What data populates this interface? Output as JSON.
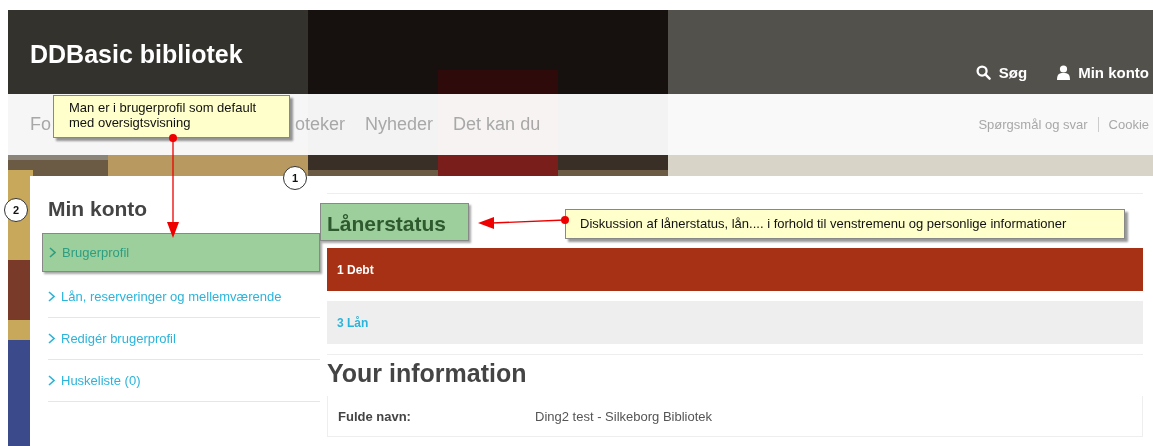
{
  "header": {
    "title": "DDBasic bibliotek",
    "actions": [
      {
        "label": "Søg",
        "kind": "search"
      },
      {
        "label": "Min konto",
        "kind": "account"
      }
    ]
  },
  "nav": {
    "items": [
      "Fo",
      "oteker",
      "Nyheder",
      "Det kan du"
    ],
    "links": [
      "Spørgsmål og svar",
      "Cookie"
    ]
  },
  "sidebar": {
    "title": "Min konto",
    "items": [
      {
        "label": "Brugerprofil",
        "selected": true
      },
      {
        "label": "Lån, reserveringer og mellemværende",
        "selected": false
      },
      {
        "label": "Redigér brugerprofil",
        "selected": false
      },
      {
        "label": "Huskeliste (0)",
        "selected": false
      }
    ]
  },
  "main": {
    "title": "Lånerstatus",
    "status": [
      {
        "label": "1 Debt",
        "kind": "alert"
      },
      {
        "label": "3 Lån",
        "kind": "info"
      }
    ],
    "info_title": "Your information",
    "info_rows": [
      {
        "label": "Fulde navn:",
        "value": "Ding2 test - Silkeborg Bibliotek"
      }
    ]
  },
  "annotations": {
    "markers": [
      "1",
      "2"
    ],
    "callouts": [
      "Man er i brugerprofil som default\nmed oversigtsvisning",
      "Diskussion af lånerstatus, lån.... i forhold til venstremenu og personlige informationer"
    ]
  }
}
